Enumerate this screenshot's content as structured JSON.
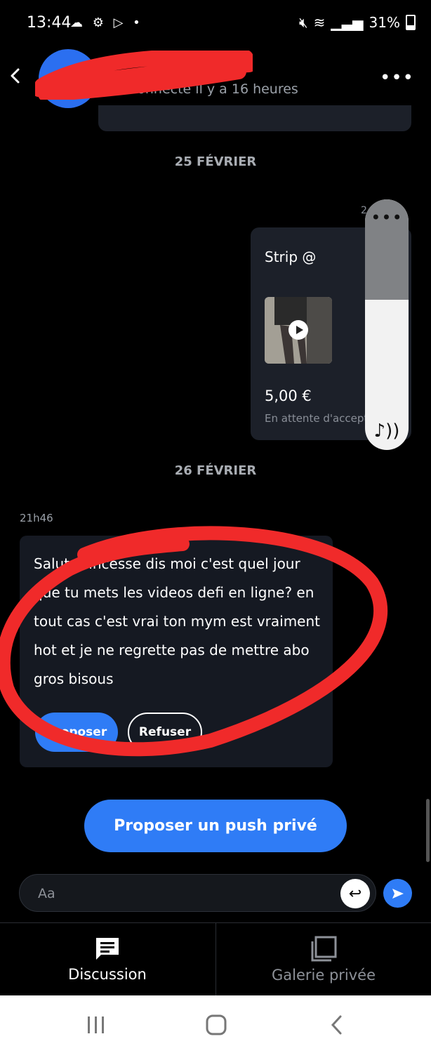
{
  "status_bar": {
    "time": "13:44",
    "left_icons": "☁ ⚙ ▷ •",
    "battery": "31%"
  },
  "header": {
    "last_seen": "Connecté il y a 16 heures",
    "more_icon": "•••"
  },
  "dates": {
    "first": "25 FÉVRIER",
    "second": "26 FÉVRIER"
  },
  "offer": {
    "time": "2",
    "title": "Strip @",
    "price": "5,00 €",
    "status": "En attente d'acceptation"
  },
  "volume_panel": {
    "dots": "•••",
    "icon": "♪))",
    "level": 0.6
  },
  "incoming": {
    "time": "21h46",
    "text": "Salut princesse dis moi c'est quel jour que tu mets les videos defi en ligne? en tout cas c'est vrai ton mym est vraiment hot et je ne regrette pas de mettre abo gros bisous",
    "accept_label": "Proposer",
    "refuse_label": "Refuser"
  },
  "push_button": "Proposer un push privé",
  "composer": {
    "placeholder": "Aa"
  },
  "tabs": [
    {
      "label": "Discussion",
      "active": true
    },
    {
      "label": "Galerie privée",
      "active": false
    }
  ],
  "colors": {
    "accent": "#2f7cf6",
    "bubble": "#1c2029",
    "redaction": "#f02a2a"
  }
}
